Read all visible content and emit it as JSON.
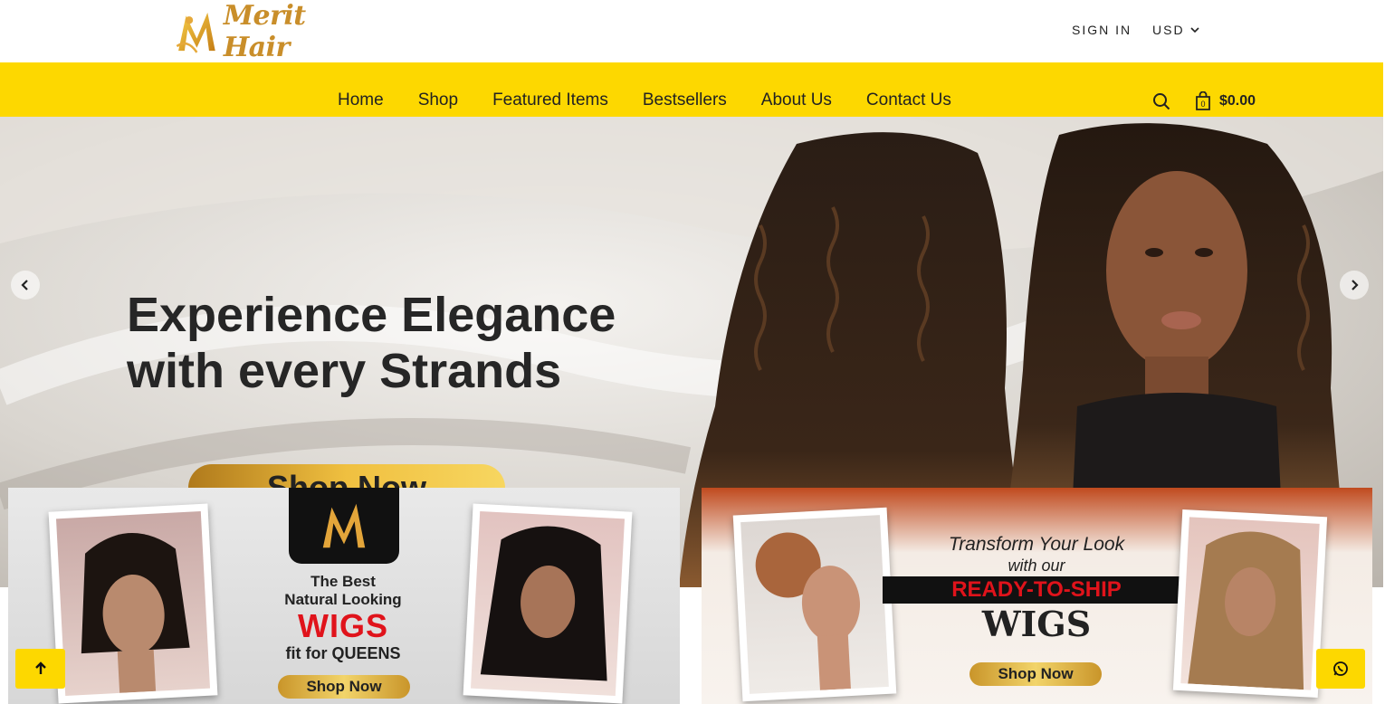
{
  "brand": {
    "name": "Merit Hair",
    "accent": "#fdd800",
    "gold": "#c98e2a"
  },
  "header": {
    "sign_in": "SIGN IN",
    "currency": "USD"
  },
  "nav": {
    "items": [
      {
        "label": "Home"
      },
      {
        "label": "Shop"
      },
      {
        "label": "Featured Items"
      },
      {
        "label": "Bestsellers"
      },
      {
        "label": "About Us"
      },
      {
        "label": "Contact Us"
      }
    ],
    "cart_count": "0",
    "cart_total": "$0.00"
  },
  "hero": {
    "headline_line1": "Experience Elegance",
    "headline_line2": "with every Strands",
    "cta": "Shop Now"
  },
  "promos": [
    {
      "line1": "The Best",
      "line2": "Natural Looking",
      "line3": "WIGS",
      "line4": "fit for QUEENS",
      "cta": "Shop Now"
    },
    {
      "line1": "Transform Your Look",
      "line2": "with our",
      "line3": "READY-TO-SHIP",
      "line4": "WIGS",
      "cta": "Shop Now"
    }
  ],
  "icons": {
    "search": "search-icon",
    "bag": "shopping-bag-icon",
    "arrow_up": "arrow-up-icon",
    "whatsapp": "whatsapp-icon",
    "prev": "chevron-left-icon",
    "next": "chevron-right-icon"
  }
}
